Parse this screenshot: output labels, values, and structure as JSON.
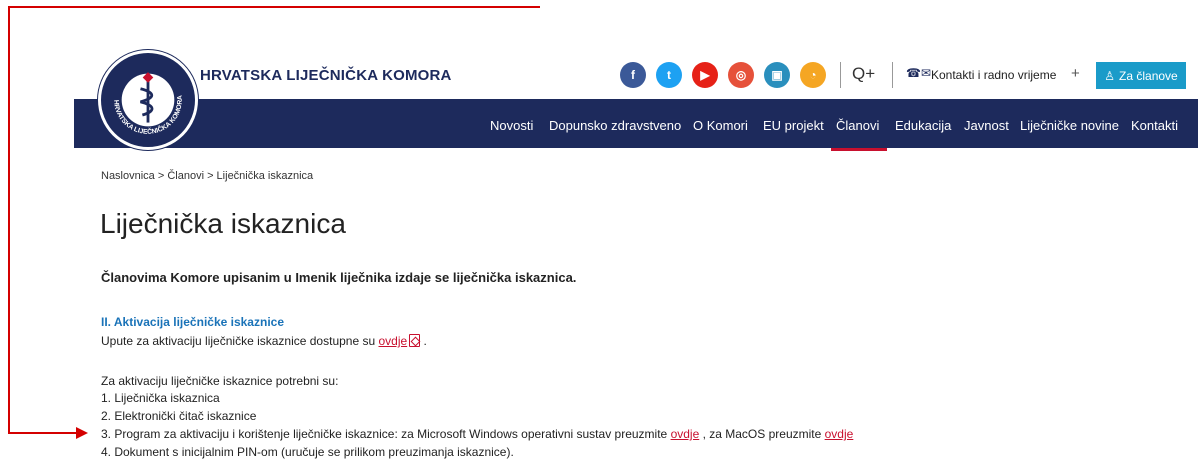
{
  "annotation": {
    "top_text": "",
    "color": "#d40000"
  },
  "header": {
    "brand": "HRVATSKA LIJEČNIČKA KOMORA",
    "logo_ring_text": "HRVATSKA LIJEČNIČKA KOMORA",
    "social": [
      {
        "name": "facebook",
        "glyph": "f",
        "color": "#3b5998"
      },
      {
        "name": "twitter",
        "glyph": "t",
        "color": "#1da1f2"
      },
      {
        "name": "youtube",
        "glyph": "▶",
        "color": "#e62117"
      },
      {
        "name": "instagram",
        "glyph": "◎",
        "color": "#e6513a"
      },
      {
        "name": "app",
        "glyph": "▣",
        "color": "#2a8fbd"
      },
      {
        "name": "rss",
        "glyph": "◔",
        "color": "#f5a623"
      }
    ],
    "search_glyph": "Q+",
    "contact_label": "Kontakti i radno vrijeme",
    "contact_plus": "+",
    "members_button": "Za članove"
  },
  "nav": {
    "items": [
      "Novosti",
      "Dopunsko zdravstveno",
      "O Komori",
      "EU projekt",
      "Članovi",
      "Edukacija",
      "Javnost",
      "Liječničke novine",
      "Kontakti"
    ],
    "active": "Članovi"
  },
  "breadcrumb": "Naslovnica > Članovi > Liječnička iskaznica",
  "content": {
    "title": "Liječnička iskaznica",
    "lead": "Članovima Komore upisanim u Imenik liječnika izdaje se liječnička iskaznica.",
    "section_heading": "II. Aktivacija liječničke iskaznice",
    "instructions_prefix": "Upute za aktivaciju liječničke iskaznice dostupne su ",
    "instructions_link": "ovdje",
    "instructions_suffix": " .",
    "requirements_intro": "Za aktivaciju liječničke iskaznice potrebni su:",
    "item1": "1. Liječnička iskaznica",
    "item2": "2. Elektronički čitač iskaznice",
    "item3_prefix": "3. Program za aktivaciju i korištenje liječničke iskaznice: za Microsoft Windows operativni sustav preuzmite ",
    "item3_link1": "ovdje",
    "item3_middle": " , za MacOS preuzmite ",
    "item3_link2": "ovdje",
    "item4": "4. Dokument s inicijalnim PIN-om (uručuje se prilikom preuzimanja iskaznice)."
  }
}
